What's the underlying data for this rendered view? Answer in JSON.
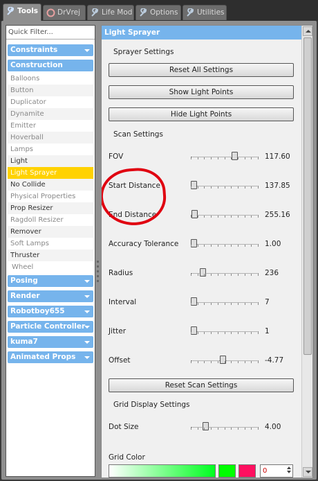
{
  "tabs": [
    {
      "label": "Tools",
      "icon": "wrench-icon"
    },
    {
      "label": "DrVrej",
      "icon": "lifebuoy-icon"
    },
    {
      "label": "Life Mod",
      "icon": "wrench-icon"
    },
    {
      "label": "Options",
      "icon": "wrench-icon"
    },
    {
      "label": "Utilities",
      "icon": "wrench-icon"
    }
  ],
  "sidebar": {
    "filter_placeholder": "Quick Filter...",
    "cat_constraints": "Constraints",
    "cat_construction": "Construction",
    "items": [
      "Balloons",
      "Button",
      "Duplicator",
      "Dynamite",
      "Emitter",
      "Hoverball",
      "Lamps",
      "Light",
      "Light Sprayer",
      "No Collide",
      "Physical Properties",
      "Prop Resizer",
      "Ragdoll Resizer",
      "Remover",
      "Soft Lamps",
      "Thruster",
      "Wheel"
    ],
    "selected": "Light Sprayer",
    "categories": [
      "Posing",
      "Render",
      "Robotboy655",
      "Particle Controller",
      "kuma7",
      "Animated Props"
    ]
  },
  "panel": {
    "title": "Light Sprayer",
    "sprayer_settings": "Sprayer Settings",
    "reset_all": "Reset All Settings",
    "show_points": "Show Light Points",
    "hide_points": "Hide Light Points",
    "scan_settings": "Scan Settings",
    "sliders": [
      {
        "label": "FOV",
        "value": "117.60",
        "fraction": 0.66
      },
      {
        "label": "Start Distance",
        "value": "137.85",
        "fraction": 0.0
      },
      {
        "label": "End Distance",
        "value": "255.16",
        "fraction": 0.01
      },
      {
        "label": "Accuracy Tolerance",
        "value": "1.00",
        "fraction": 0.0
      },
      {
        "label": "Radius",
        "value": "236",
        "fraction": 0.15
      },
      {
        "label": "Interval",
        "value": "7",
        "fraction": 0.0
      },
      {
        "label": "Jitter",
        "value": "1",
        "fraction": 0.0
      },
      {
        "label": "Offset",
        "value": "-4.77",
        "fraction": 0.47
      }
    ],
    "reset_scan": "Reset Scan Settings",
    "grid_settings": "Grid Display Settings",
    "dot_size": {
      "label": "Dot Size",
      "value": "4.00",
      "fraction": 0.19
    },
    "grid_color": "Grid Color",
    "color_value": "0"
  },
  "colors": {
    "accent": "#76b4ec",
    "selected": "#ffd200",
    "annotation": "#e00010"
  }
}
